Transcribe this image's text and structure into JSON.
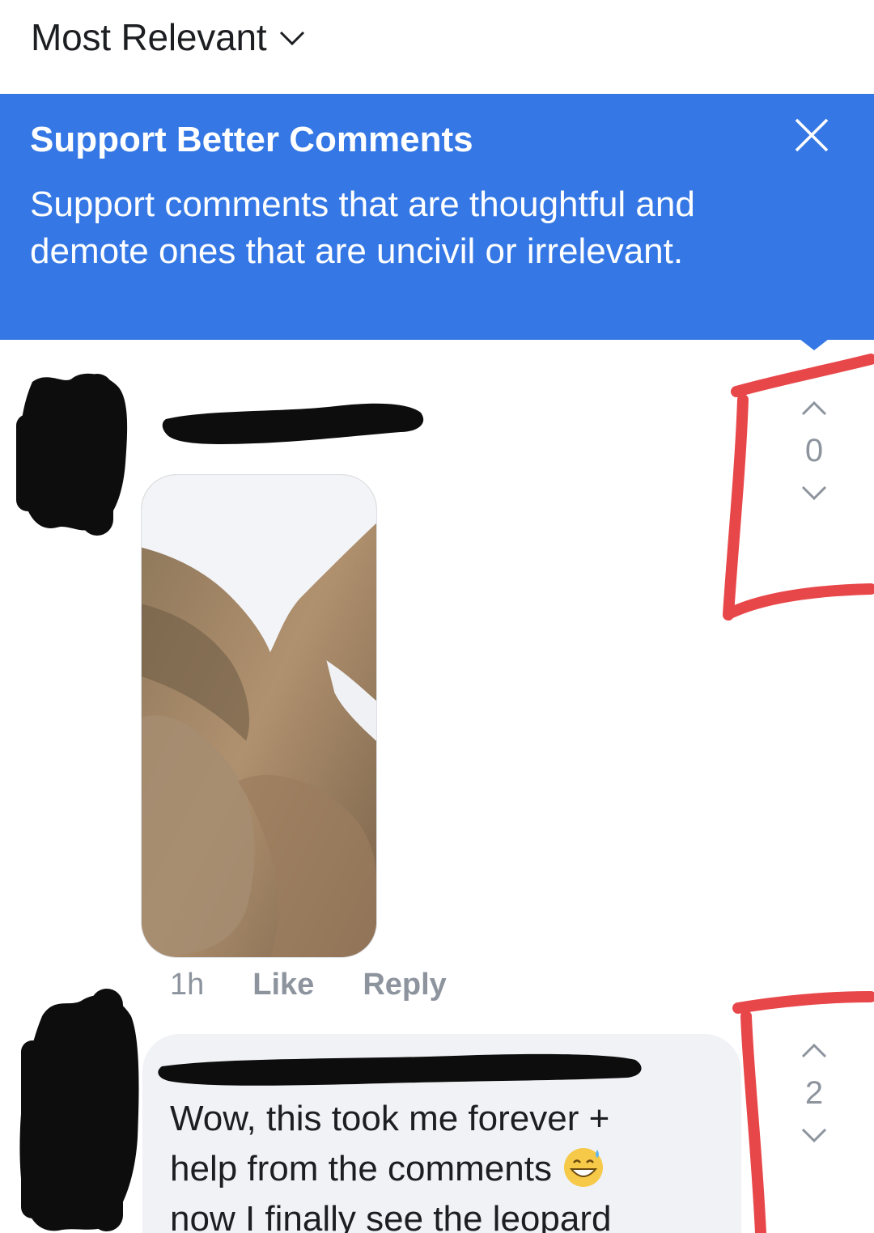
{
  "sort": {
    "label": "Most Relevant"
  },
  "banner": {
    "title": "Support Better Comments",
    "body": "Support comments that are thoughtful and demote ones that are uncivil or irrelevant."
  },
  "comments": [
    {
      "time": "1h",
      "like_label": "Like",
      "reply_label": "Reply",
      "vote_count": "0"
    },
    {
      "text_line1": "Wow, this took me forever +",
      "text_line2": "help from the comments",
      "text_line3": "now I finally see the leopard",
      "vote_count": "2"
    }
  ],
  "colors": {
    "banner_bg": "#3578e5",
    "annotation": "#e8474a",
    "redaction": "#0d0d0d",
    "muted": "#8d949e"
  }
}
